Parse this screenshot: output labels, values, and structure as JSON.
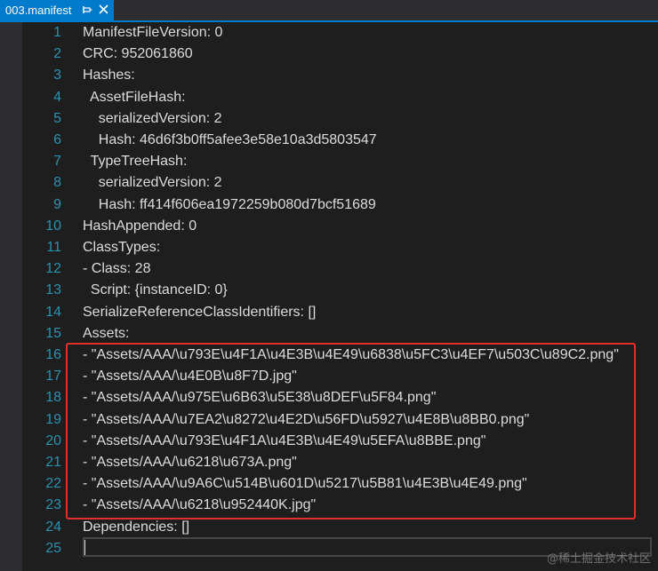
{
  "tab": {
    "title": "003.manifest",
    "pin_icon": "pin-icon",
    "close_icon": "close-icon"
  },
  "editor": {
    "lines": [
      {
        "number": "1",
        "text": "ManifestFileVersion: 0"
      },
      {
        "number": "2",
        "text": "CRC: 952061860"
      },
      {
        "number": "3",
        "text": "Hashes:"
      },
      {
        "number": "4",
        "text": "  AssetFileHash:"
      },
      {
        "number": "5",
        "text": "    serializedVersion: 2"
      },
      {
        "number": "6",
        "text": "    Hash: 46d6f3b0ff5afee3e58e10a3d5803547"
      },
      {
        "number": "7",
        "text": "  TypeTreeHash:"
      },
      {
        "number": "8",
        "text": "    serializedVersion: 2"
      },
      {
        "number": "9",
        "text": "    Hash: ff414f606ea1972259b080d7bcf51689"
      },
      {
        "number": "10",
        "text": "HashAppended: 0"
      },
      {
        "number": "11",
        "text": "ClassTypes:"
      },
      {
        "number": "12",
        "text": "- Class: 28"
      },
      {
        "number": "13",
        "text": "  Script: {instanceID: 0}"
      },
      {
        "number": "14",
        "text": "SerializeReferenceClassIdentifiers: []"
      },
      {
        "number": "15",
        "text": "Assets:"
      },
      {
        "number": "16",
        "text": "- \"Assets/AAA/\\u793E\\u4F1A\\u4E3B\\u4E49\\u6838\\u5FC3\\u4EF7\\u503C\\u89C2.png\""
      },
      {
        "number": "17",
        "text": "- \"Assets/AAA/\\u4E0B\\u8F7D.jpg\""
      },
      {
        "number": "18",
        "text": "- \"Assets/AAA/\\u975E\\u6B63\\u5E38\\u8DEF\\u5F84.png\""
      },
      {
        "number": "19",
        "text": "- \"Assets/AAA/\\u7EA2\\u8272\\u4E2D\\u56FD\\u5927\\u4E8B\\u8BB0.png\""
      },
      {
        "number": "20",
        "text": "- \"Assets/AAA/\\u793E\\u4F1A\\u4E3B\\u4E49\\u5EFA\\u8BBE.png\""
      },
      {
        "number": "21",
        "text": "- \"Assets/AAA/\\u6218\\u673A.png\""
      },
      {
        "number": "22",
        "text": "- \"Assets/AAA/\\u9A6C\\u514B\\u601D\\u5217\\u5B81\\u4E3B\\u4E49.png\""
      },
      {
        "number": "23",
        "text": "- \"Assets/AAA/\\u6218\\u952440K.jpg\""
      },
      {
        "number": "24",
        "text": "Dependencies: []"
      },
      {
        "number": "25",
        "text": ""
      }
    ]
  },
  "highlight_color": "#e0302a",
  "accent_color": "#007acc",
  "line_number_color": "#2b91af",
  "watermark": "@稀土掘金技术社区"
}
